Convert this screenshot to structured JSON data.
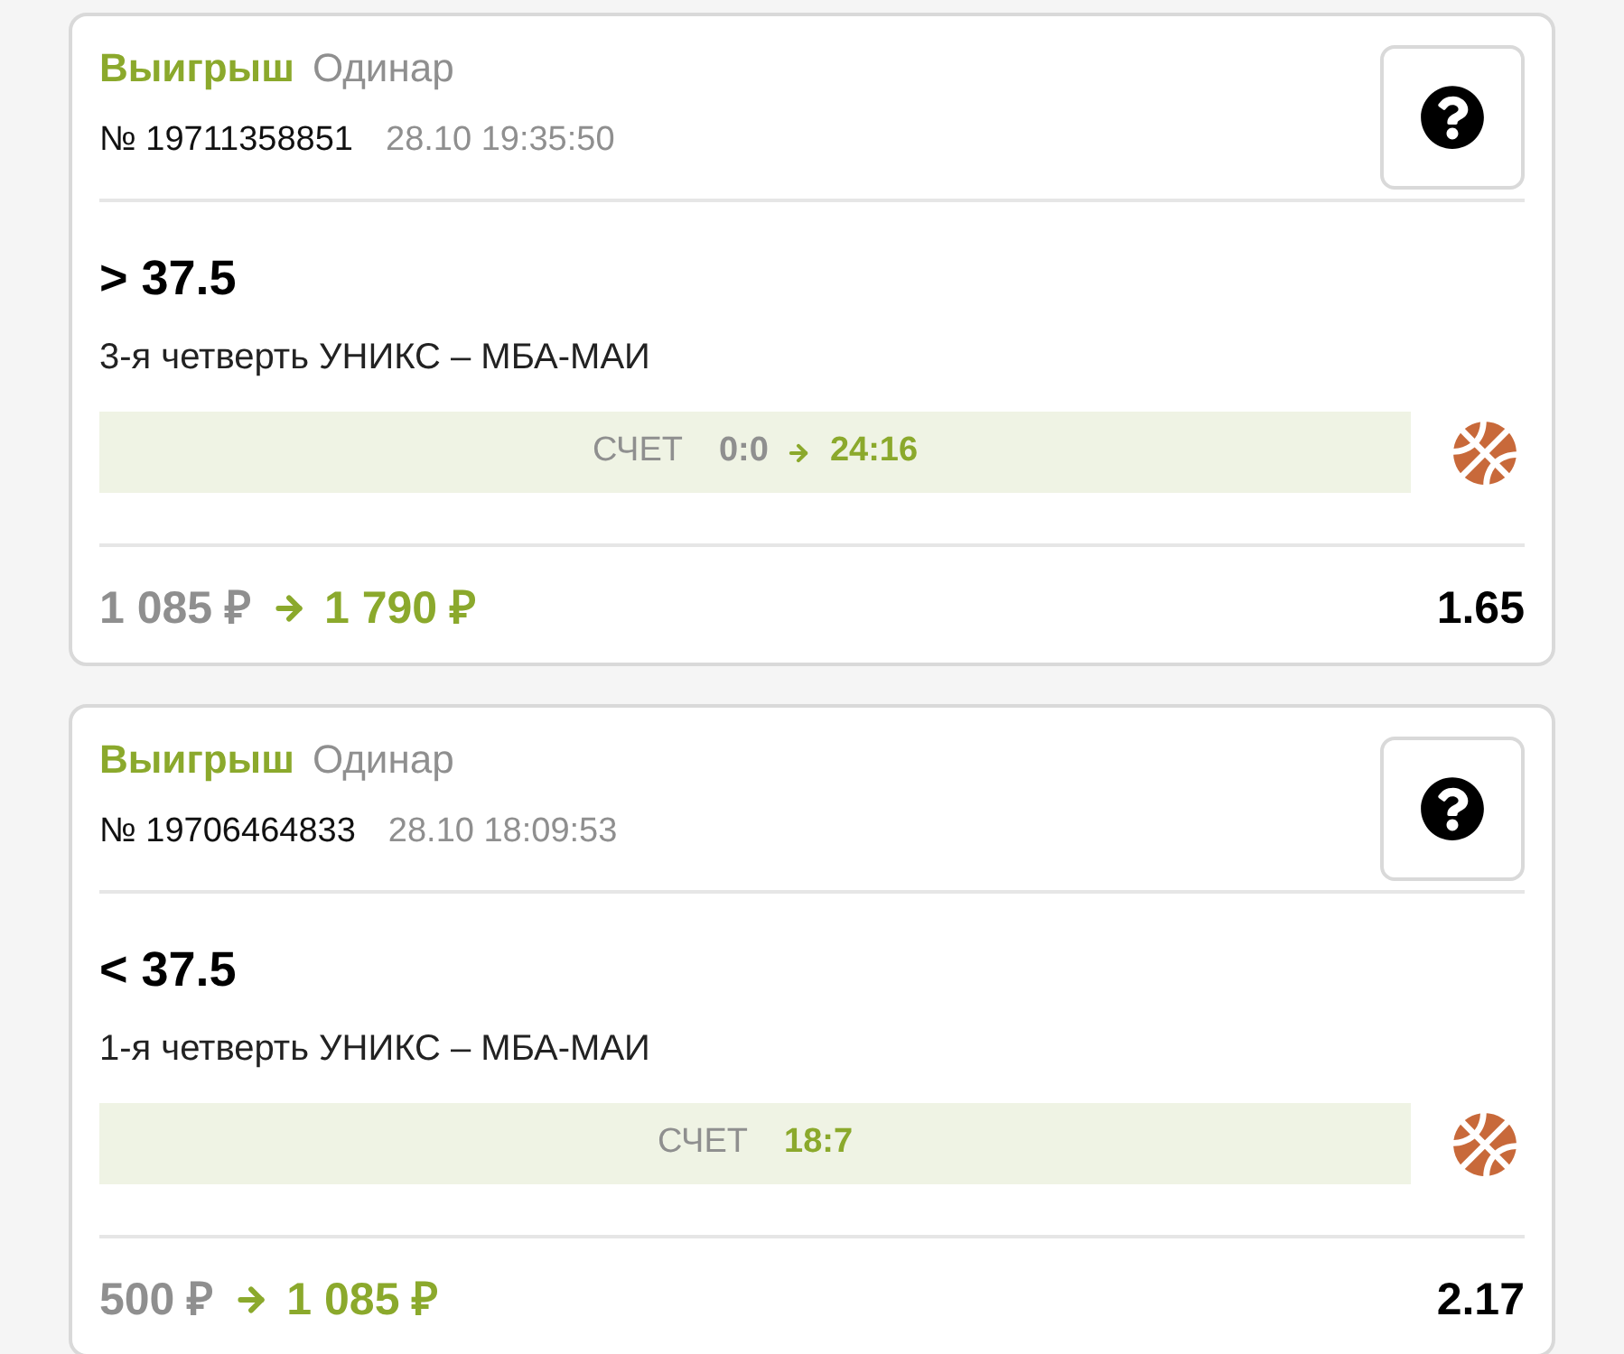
{
  "bets": [
    {
      "kind": "won",
      "status": "Выигрыш",
      "bet_type": "Одинар",
      "number": "№ 19711358851",
      "datetime": "28.10 19:35:50",
      "selection": "> 37.5",
      "event": "3-я четверть УНИКС – МБА-МАИ",
      "score": {
        "label": "СЧЕТ",
        "from": "0:0",
        "to": "24:16"
      },
      "stake": "1 085 ₽",
      "payout": "1 790 ₽",
      "odds": "1.65"
    },
    {
      "kind": "won",
      "status": "Выигрыш",
      "bet_type": "Одинар",
      "number": "№ 19706464833",
      "datetime": "28.10 18:09:53",
      "selection": "< 37.5",
      "event": "1-я четверть УНИКС – МБА-МАИ",
      "score": {
        "label": "СЧЕТ",
        "to": "18:7"
      },
      "stake": "500 ₽",
      "payout": "1 085 ₽",
      "odds": "2.17"
    }
  ]
}
